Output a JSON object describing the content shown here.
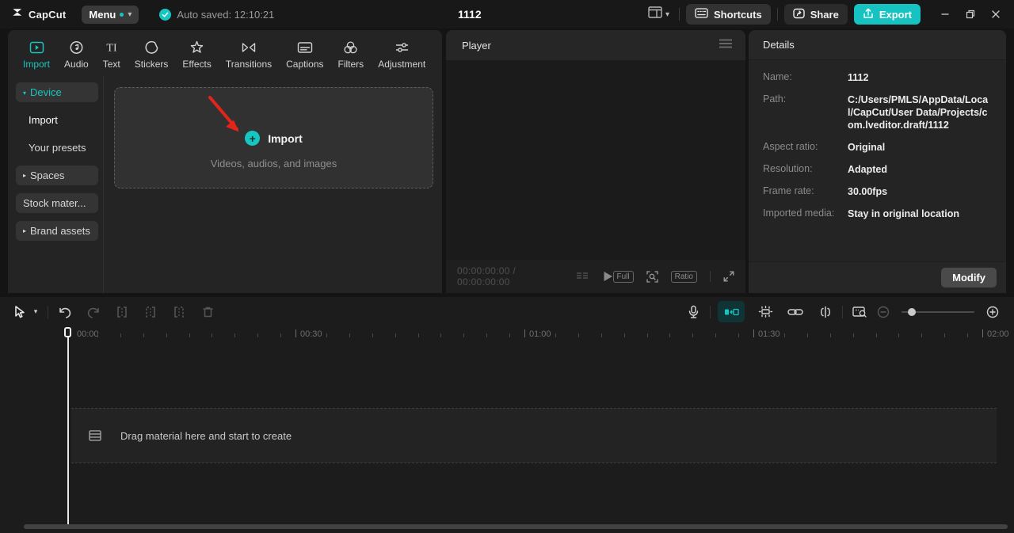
{
  "colors": {
    "accent": "#18c6c1",
    "export_bg": "#17c3c0",
    "arrow_red": "#e3241b",
    "panel_bg": "#242424"
  },
  "titlebar": {
    "app_name": "CapCut",
    "menu_label": "Menu",
    "autosave_text": "Auto saved: 12:10:21",
    "project_title": "1112",
    "shortcuts_label": "Shortcuts",
    "share_label": "Share",
    "export_label": "Export"
  },
  "tabs": [
    {
      "label": "Import"
    },
    {
      "label": "Audio"
    },
    {
      "label": "Text"
    },
    {
      "label": "Stickers"
    },
    {
      "label": "Effects"
    },
    {
      "label": "Transitions"
    },
    {
      "label": "Captions"
    },
    {
      "label": "Filters"
    },
    {
      "label": "Adjustment"
    }
  ],
  "sidebar": {
    "items": [
      {
        "label": "Device"
      },
      {
        "label": "Import"
      },
      {
        "label": "Your presets"
      },
      {
        "label": "Spaces"
      },
      {
        "label": "Stock mater..."
      },
      {
        "label": "Brand assets"
      }
    ]
  },
  "import_area": {
    "plus": "+",
    "title": "Import",
    "subtitle": "Videos, audios, and images"
  },
  "player": {
    "title": "Player",
    "timecode": "00:00:00:00 / 00:00:00:00",
    "full_label": "Full",
    "ratio_label": "Ratio"
  },
  "details": {
    "title": "Details",
    "rows": [
      {
        "label": "Name:",
        "value": "1112"
      },
      {
        "label": "Path:",
        "value": "C:/Users/PMLS/AppData/Local/CapCut/User Data/Projects/com.lveditor.draft/1112"
      },
      {
        "label": "Aspect ratio:",
        "value": "Original"
      },
      {
        "label": "Resolution:",
        "value": "Adapted"
      },
      {
        "label": "Frame rate:",
        "value": "30.00fps"
      },
      {
        "label": "Imported media:",
        "value": "Stay in original location"
      }
    ],
    "modify_label": "Modify"
  },
  "timeline": {
    "ruler_labels": [
      "00:00",
      "00:30",
      "01:00",
      "01:30",
      "02:00"
    ],
    "drag_hint": "Drag material here and start to create"
  }
}
